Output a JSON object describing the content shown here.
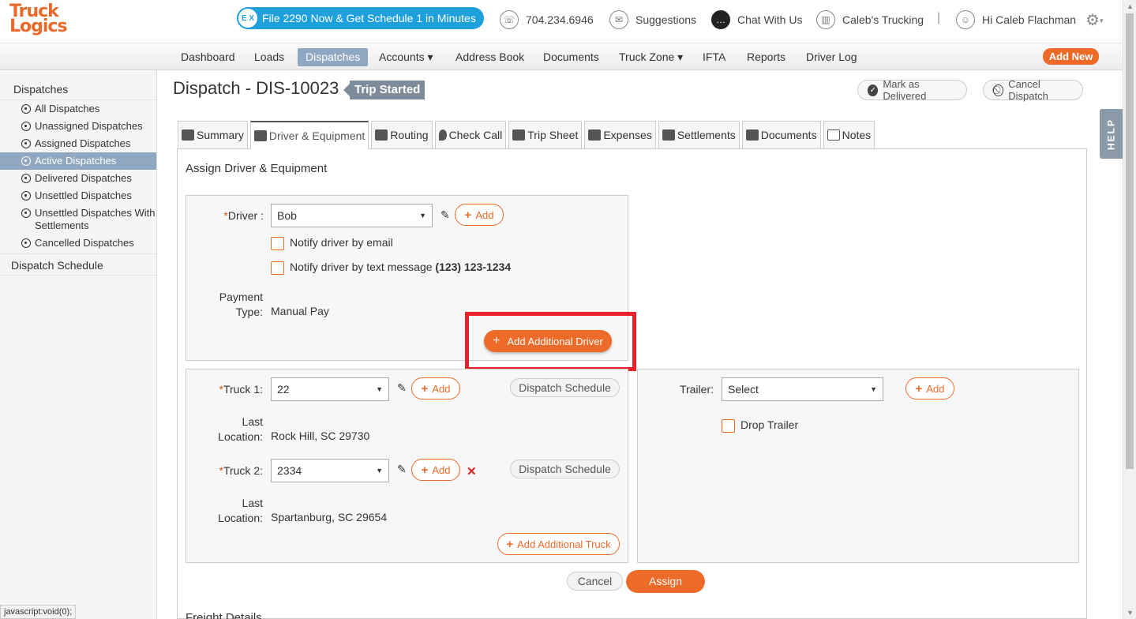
{
  "header": {
    "logo_line1": "Truck",
    "logo_line2": "Logics",
    "promo_badge": "E X",
    "promo_text": "File 2290 Now & Get Schedule 1 in Minutes",
    "phone": "704.234.6946",
    "suggestions": "Suggestions",
    "chat": "Chat With Us",
    "company": "Caleb's Trucking",
    "separator": "|",
    "greeting": "Hi Caleb Flachman"
  },
  "nav": {
    "items": [
      "Dashboard",
      "Loads",
      "Dispatches",
      "Accounts ▾",
      "Address Book",
      "Documents",
      "Truck Zone ▾",
      "IFTA",
      "Reports",
      "Driver Log"
    ],
    "add_new": "Add New"
  },
  "sidebar": {
    "heading": "Dispatches",
    "items": [
      "All Dispatches",
      "Unassigned Dispatches",
      "Assigned Dispatches",
      "Active Dispatches",
      "Delivered Dispatches",
      "Unsettled Dispatches",
      "Unsettled Dispatches With Settlements",
      "Cancelled Dispatches"
    ],
    "schedule": "Dispatch Schedule"
  },
  "page": {
    "title": "Dispatch - DIS-10023",
    "status": "Trip Started",
    "mark_delivered": "Mark as Delivered",
    "cancel_dispatch": "Cancel Dispatch"
  },
  "tabs": [
    "Summary",
    "Driver & Equipment",
    "Routing",
    "Check Call",
    "Trip Sheet",
    "Expenses",
    "Settlements",
    "Documents",
    "Notes"
  ],
  "form": {
    "section_title": "Assign Driver & Equipment",
    "driver_label": "Driver :",
    "driver_value": "Bob",
    "add": "Add",
    "notify_email": "Notify driver by email",
    "notify_text": "Notify driver by text message",
    "notify_phone": "(123) 123-1234",
    "payment_label_1": "Payment",
    "payment_label_2": "Type:",
    "payment_value": "Manual Pay",
    "add_additional_driver": "Add Additional Driver",
    "truck1_label": "Truck 1:",
    "truck1_value": "22",
    "dispatch_schedule": "Dispatch Schedule",
    "last_label": "Last",
    "location_label": "Location:",
    "truck1_location": "Rock Hill, SC 29730",
    "truck2_label": "Truck 2:",
    "truck2_value": "2334",
    "truck2_location": "Spartanburg, SC 29654",
    "add_additional_truck": "Add Additional Truck",
    "trailer_label": "Trailer:",
    "trailer_value": "Select",
    "drop_trailer": "Drop Trailer",
    "cancel": "Cancel",
    "assign": "Assign",
    "freight_details": "Freight Details"
  },
  "help": "HELP",
  "statusbar": "javascript:void(0);",
  "colors": {
    "accent": "#ee6a29",
    "nav_active": "#8fa7c0",
    "promo": "#1ea0dc",
    "highlight": "#e8202a"
  }
}
